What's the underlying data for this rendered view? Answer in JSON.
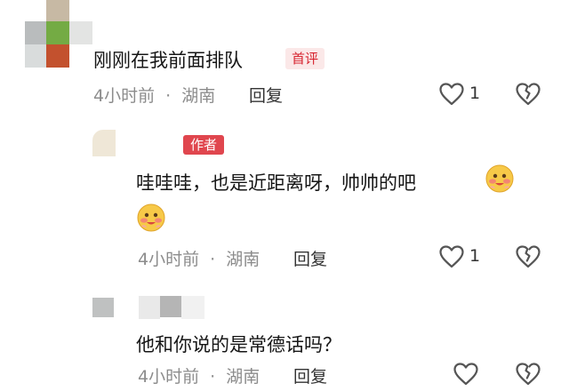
{
  "comments": [
    {
      "text": "刚刚在我前面排队",
      "badge": "首评",
      "time": "4小时前",
      "location": "湖南",
      "reply": "回复",
      "likes": "1"
    },
    {
      "badge": "作者",
      "text": "哇哇哇，也是近距离呀，帅帅的吧",
      "time": "4小时前",
      "location": "湖南",
      "reply": "回复",
      "likes": "1"
    },
    {
      "text": "他和你说的是常德话吗？",
      "time": "4小时前",
      "location": "湖南",
      "reply": "回复"
    }
  ],
  "meta_separator": "·",
  "icons": {
    "like": "heart-outline-icon",
    "dislike": "broken-heart-icon",
    "emoji": "blushing-emoji-icon"
  },
  "colors": {
    "badge_first_text": "#d7242f",
    "badge_first_bg": "#fbe8e8",
    "badge_author_bg": "#e0464e",
    "meta_gray": "#8c8c8c"
  }
}
